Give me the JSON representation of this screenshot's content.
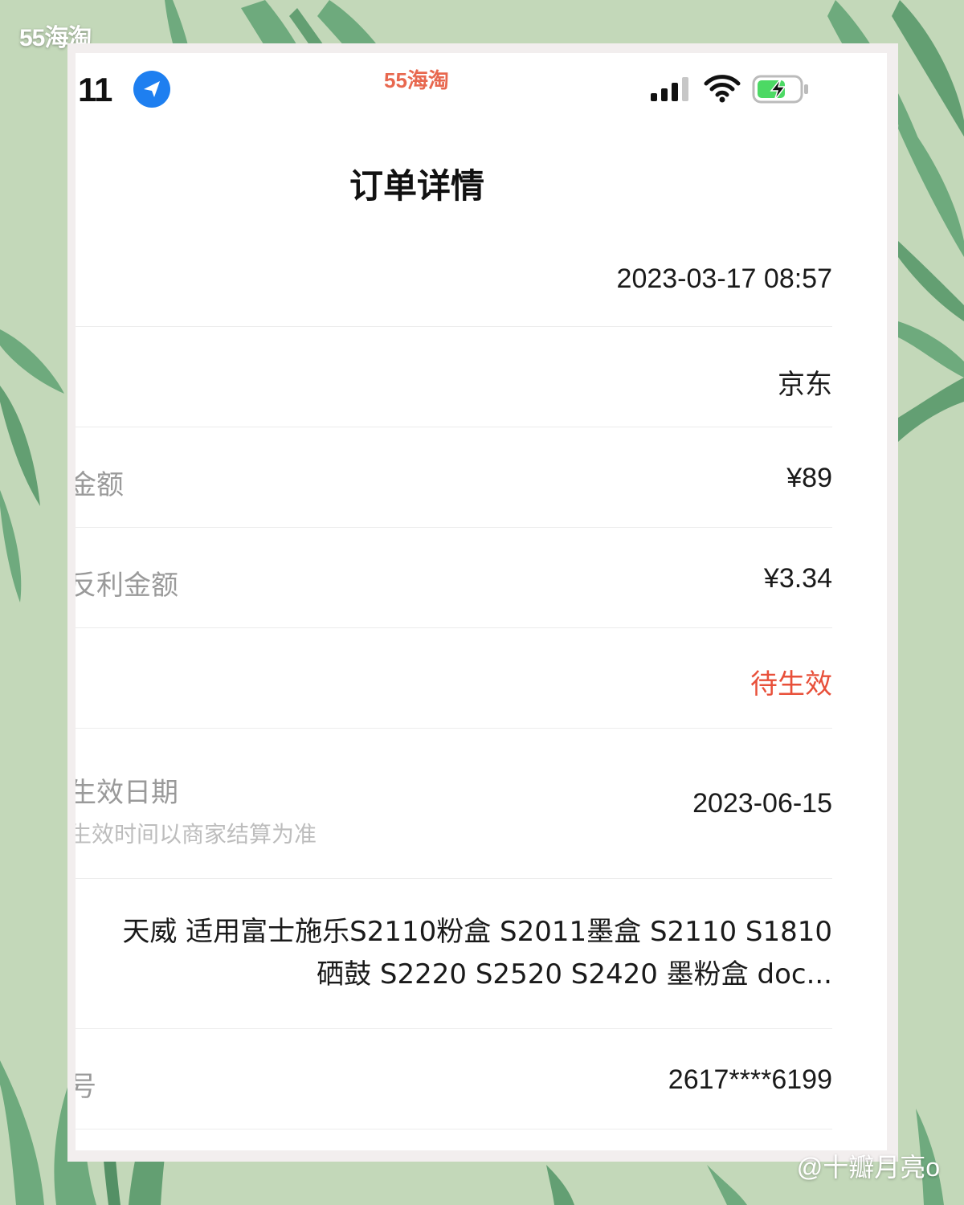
{
  "watermarks": {
    "top_left": "55海淘",
    "bottom_right": "@十瓣月亮o"
  },
  "status_bar": {
    "time": ":11",
    "center_mark": "55海淘",
    "icons": [
      "location-arrow-icon",
      "cellular-signal-icon",
      "wifi-icon",
      "battery-charging-icon"
    ],
    "location_icon_color": "#1e7ff0",
    "battery_color": "#4cd964"
  },
  "page": {
    "title": "订单详情"
  },
  "rows": [
    {
      "label": "",
      "value": "2023-03-17 08:57"
    },
    {
      "label": "",
      "value": "京东"
    },
    {
      "label": "金额",
      "value": "¥89"
    },
    {
      "label": "反利金额",
      "value": "¥3.34"
    },
    {
      "label": "",
      "value": "待生效"
    },
    {
      "label": "生效日期",
      "sublabel": "生效时间以商家结算为准",
      "value": "2023-06-15"
    },
    {
      "label": "",
      "value": "天威 适用富士施乐S2110粉盒 S2011墨盒 S2110 S1810硒鼓 S2220 S2520 S2420 墨粉盒 doc..."
    },
    {
      "label": "号",
      "value": "2617****6199"
    }
  ],
  "colors": {
    "status_pending": "#e8503a",
    "background_green": "#c3d8b9",
    "leaf_green": "#6aa87a"
  }
}
